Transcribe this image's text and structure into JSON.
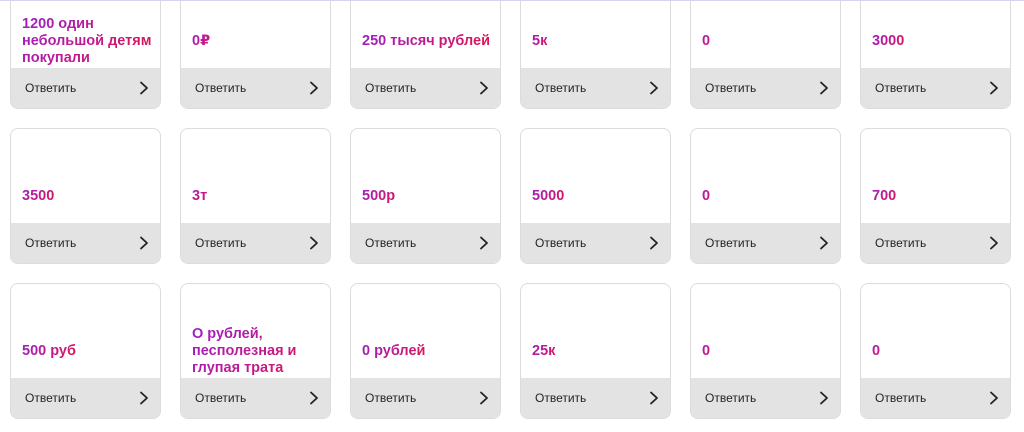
{
  "reply_label": "Ответить",
  "icon": "chevron-right-icon",
  "colors": {
    "answer_gradient_start": "#9b1fc9",
    "answer_gradient_end": "#e01545",
    "reply_bar_bg": "#e3e3e3",
    "card_border": "#dcdcdc"
  },
  "cards": [
    {
      "text": "1200 один небольшой детям покупали"
    },
    {
      "text": "0₽"
    },
    {
      "text": "250 тысяч рублей"
    },
    {
      "text": "5к"
    },
    {
      "text": "0"
    },
    {
      "text": "3000"
    },
    {
      "text": "3500"
    },
    {
      "text": "3т"
    },
    {
      "text": "500р"
    },
    {
      "text": "5000"
    },
    {
      "text": "0"
    },
    {
      "text": "700"
    },
    {
      "text": "500 руб"
    },
    {
      "text": "О рублей, песполезная и глупая трата"
    },
    {
      "text": "0 рублей"
    },
    {
      "text": "25к"
    },
    {
      "text": "0"
    },
    {
      "text": "0"
    }
  ]
}
